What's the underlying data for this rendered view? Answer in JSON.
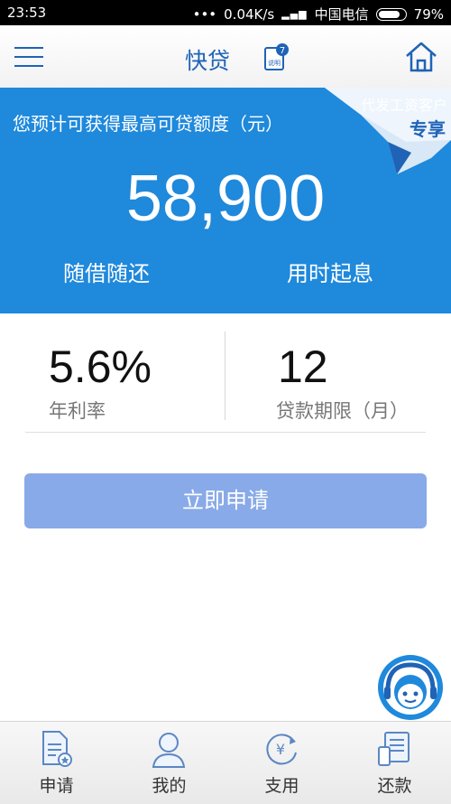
{
  "status_bar": {
    "time": "23:53",
    "network_speed": "0.04K/s",
    "carrier": "中国电信",
    "battery": "79%",
    "battery_level": 0.79
  },
  "header": {
    "title": "快贷",
    "doc_badge": "7",
    "doc_label": "说明"
  },
  "banner": {
    "subtitle": "您预计可获得最高可贷额度（元）",
    "amount": "58,900",
    "feature_left": "随借随还",
    "feature_right": "用时起息",
    "ribbon_line1": "代发工资客户",
    "ribbon_line2": "专享"
  },
  "info": {
    "rate_value": "5.6%",
    "rate_label": "年利率",
    "term_value": "12",
    "term_label": "贷款期限（月）"
  },
  "apply_button": "立即申请",
  "bottom_nav": [
    {
      "label": "申请",
      "icon": "apply-doc-icon"
    },
    {
      "label": "我的",
      "icon": "user-icon"
    },
    {
      "label": "支用",
      "icon": "yuan-cycle-icon"
    },
    {
      "label": "还款",
      "icon": "repay-icon"
    }
  ],
  "colors": {
    "brand_blue": "#1f63b6",
    "banner_blue": "#1f89dc",
    "button_blue": "#88aae8"
  }
}
